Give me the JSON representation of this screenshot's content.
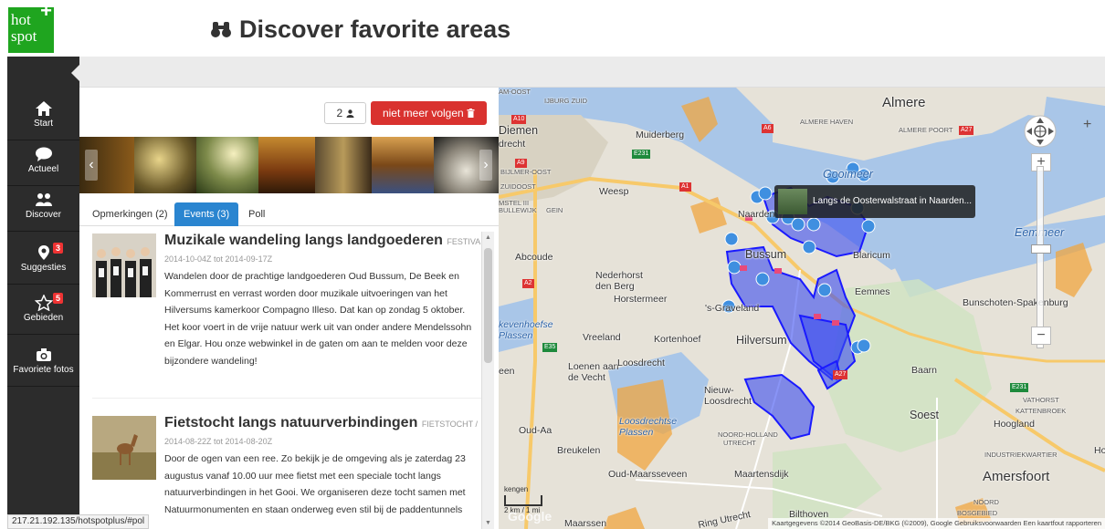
{
  "logo": {
    "line1": "hot",
    "line2": "spot",
    "plus": "+"
  },
  "header": {
    "title": "Discover favorite areas",
    "title_icon": "binoculars-icon"
  },
  "sidebar": {
    "items": [
      {
        "label": "Start",
        "icon": "home-icon"
      },
      {
        "label": "Actueel",
        "icon": "chat-bubble-icon"
      },
      {
        "label": "Discover",
        "icon": "group-icon"
      },
      {
        "label": "Suggesties",
        "icon": "map-marker-icon",
        "badge": "3"
      },
      {
        "label": "Gebieden",
        "icon": "star-icon",
        "badge": "5"
      },
      {
        "label": "Favoriete fotos",
        "icon": "camera-icon"
      }
    ]
  },
  "actions": {
    "follow_count": "2",
    "follow_icon": "user-icon",
    "unfollow_label": "niet meer volgen",
    "unfollow_icon": "trash-icon"
  },
  "tabs": [
    {
      "label": "Opmerkingen (2)",
      "active": false
    },
    {
      "label": "Events (3)",
      "active": true
    },
    {
      "label": "Poll",
      "active": false
    }
  ],
  "events": [
    {
      "title": "Muzikale wandeling langs landgoederen",
      "tag": "FESTIVAL /",
      "date": "2014-10-04Z tot 2014-09-17Z",
      "description": "Wandelen door de prachtige landgoederen Oud Bussum, De Beek en Kommerrust en verrast worden door muzikale uitvoeringen van het Hilversums kamerkoor Compagno Illeso. Dat kan op zondag 5 oktober. Het koor voert in de vrije natuur werk uit van onder andere Mendelssohn en Elgar. Hou onze webwinkel in de gaten om aan te melden voor deze bijzondere wandeling!"
    },
    {
      "title": "Fietstocht langs natuurverbindingen",
      "tag": "FIETSTOCHT /",
      "date": "2014-08-22Z tot 2014-08-20Z",
      "description": "Door de ogen van een ree. Zo bekijk je de omgeving als je zaterdag 23 augustus vanaf 10.00 uur mee fietst met een speciale tocht langs natuurverbindingen in het Gooi. We organiseren deze tocht samen met Natuurmonumenten en staan onderweg even stil bij de paddentunnels"
    }
  ],
  "statusbar": {
    "url": "217.21.192.135/hotspotplus/#pol"
  },
  "map": {
    "tooltip": "Langs de Oosterwalstraat in Naarden...",
    "labels": {
      "almere": "Almere",
      "almere_haven": "ALMERE HAVEN",
      "almere_poort": "ALMERE POORT",
      "diemen": "Diemen",
      "amsterdam_oost": "AM-OOST",
      "drecht": "drecht",
      "muiderberg": "Muiderberg",
      "weesp": "Weesp",
      "gooimeer": "Gooimeer",
      "eemmeer": "Eemmeer",
      "naarden": "Naarden",
      "bussum": "Bussum",
      "blaricum": "Blaricum",
      "abcoude": "Abcoude",
      "nederhorst": "Nederhorst\nden Berg",
      "horstermeer": "Horstermeer",
      "eemnes": "Eemnes",
      "bunschoten": "Bunschoten-Spakenburg",
      "graveland": "'s-Graveland",
      "vreeland": "Vreeland",
      "kortenhoef": "Kortenhoef",
      "hilversum": "Hilversum",
      "loenen": "Loenen aan\nde Vecht",
      "loosdrecht": "Loosdrecht",
      "baarn": "Baarn",
      "nieuw_loosdrecht": "Nieuw-\nLoosdrecht",
      "loosdrechtse_plassen": "Loosdrechtse\nPlassen",
      "oud_aa": "Oud-Aa",
      "breukelen": "Breukelen",
      "soest": "Soest",
      "hoogland": "Hoogland",
      "oud_maarsseveen": "Oud-Maarsseveen",
      "maartensdijk": "Maartensdijk",
      "amersfoort": "Amersfoort",
      "bilthoven": "Bilthoven",
      "maarssen": "Maarssen",
      "vathorst": "VATHORST",
      "kattenbroek": "KATTENBROEK",
      "noord_holland": "NOORD-HOLLAND",
      "utrecht": "UTRECHT",
      "industriekwartier": "INDUSTRIEKWARTIER",
      "ring_utrecht": "Ring Utrecht",
      "hoe": "Hoe",
      "literatuurwijk": "LITERATUURWIJK",
      "uburg_zuid": "IJBURG ZUID",
      "bijlmer_oost": "BIJLMER-OOST",
      "zuidoost": "ZUIDOOST",
      "bullewijk": "BULLEWIJK",
      "gein": "GEIN",
      "amstel": "MSTEL III",
      "kevenhoefse_plassen": "kevenhoefse\nPlassen",
      "een": "een",
      "bosgebied": "BOSGEBIED",
      "noord": "NOORD",
      "kenn": "kengen"
    },
    "shields": {
      "a10": "A10",
      "a9": "A9",
      "a6": "A6",
      "a27": "A27",
      "a1": "A1",
      "a2": "A2",
      "a35": "E35",
      "e231": "E231",
      "e231b": "E231",
      "a27b": "A27"
    },
    "scale": {
      "km": "2 km",
      "mi": "1 mi"
    },
    "copyright": "Kaartgegevens ©2014 GeoBasis-DE/BKG (©2009), Google   Gebruiksvoorwaarden   Een kaartfout rapporteren",
    "google": "Google",
    "fullscreen": "+",
    "zoom_in": "+",
    "zoom_out": "−",
    "colors": {
      "water": "#a9c6e8",
      "land": "#e6e2d8",
      "area": "#1a1aff",
      "marker": "#3f8fe0",
      "flag": "#e84a7a"
    }
  }
}
